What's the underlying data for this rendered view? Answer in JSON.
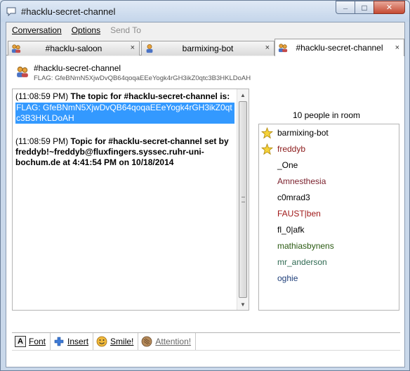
{
  "window": {
    "title": "#hacklu-secret-channel",
    "minimize_glyph": "_",
    "maximize_glyph": "□",
    "close_glyph": "✕"
  },
  "menu": {
    "items": [
      {
        "label": "Conversation",
        "enabled": true
      },
      {
        "label": "Options",
        "enabled": true
      },
      {
        "label": "Send To",
        "enabled": false
      }
    ]
  },
  "tabs": [
    {
      "label": "#hacklu-saloon",
      "icon": "people-icon",
      "active": false,
      "close": "×"
    },
    {
      "label": "barmixing-bot",
      "icon": "person-icon",
      "active": false,
      "close": "×"
    },
    {
      "label": "#hacklu-secret-channel",
      "icon": "people-icon",
      "active": true,
      "close": "×"
    }
  ],
  "header": {
    "name": "#hacklu-secret-channel",
    "topic": "FLAG: GfeBNmN5XjwDvQB64qoqaEEeYogk4rGH3ikZ0qtc3B3HKLDoAH"
  },
  "chat": {
    "messages": [
      {
        "time": "(11:08:59 PM)",
        "text": "The topic for #hacklu-secret-channel is:",
        "highlight": "FLAG: GfeBNmN5XjwDvQB64qoqaEEeYogk4rGH3ikZ0qtc3B3HKLDoAH"
      },
      {
        "time": "(11:08:59 PM)",
        "text": "Topic for #hacklu-secret-channel set by freddyb!~freddyb@fluxfingers.syssec.ruhr-uni-bochum.de at 4:41:54 PM on 10/18/2014"
      }
    ]
  },
  "people": {
    "count_label": "10 people in room",
    "list": [
      {
        "name": "barmixing-bot",
        "color": "#000000",
        "op": true
      },
      {
        "name": "freddyb",
        "color": "#8b1a1a",
        "op": true
      },
      {
        "name": "_One",
        "color": "#000000",
        "op": false
      },
      {
        "name": "Amnesthesia",
        "color": "#7a1f2b",
        "op": false
      },
      {
        "name": "c0mrad3",
        "color": "#000000",
        "op": false
      },
      {
        "name": "FAUST|ben",
        "color": "#a01818",
        "op": false
      },
      {
        "name": "fl_0|afk",
        "color": "#000000",
        "op": false
      },
      {
        "name": "mathiasbynens",
        "color": "#2a5a12",
        "op": false
      },
      {
        "name": "mr_anderson",
        "color": "#2f6a52",
        "op": false
      },
      {
        "name": "oghie",
        "color": "#1f3f7a",
        "op": false
      }
    ]
  },
  "toolbar": {
    "font_label": "Font",
    "insert_label": "Insert",
    "smile_label": "Smile!",
    "attention_label": "Attention!"
  },
  "colors": {
    "selection": "#3399ff",
    "accent": "#c54a32"
  }
}
